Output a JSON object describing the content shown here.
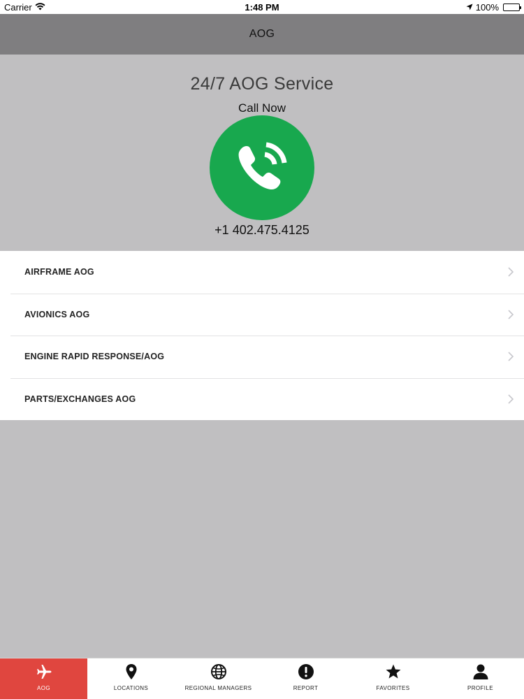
{
  "status_bar": {
    "carrier": "Carrier",
    "time": "1:48 PM",
    "battery": "100%"
  },
  "nav": {
    "title": "AOG"
  },
  "hero": {
    "title": "24/7 AOG Service",
    "call_label": "Call Now",
    "phone": "+1 402.475.4125",
    "call_button_color": "#18a84e"
  },
  "menu": {
    "items": [
      {
        "label": "AIRFRAME AOG"
      },
      {
        "label": "AVIONICS AOG"
      },
      {
        "label": "ENGINE RAPID RESPONSE/AOG"
      },
      {
        "label": "PARTS/EXCHANGES AOG"
      }
    ]
  },
  "tabs": {
    "active_color": "#e0463f",
    "items": [
      {
        "label": "AOG",
        "icon": "airplane-icon",
        "active": true
      },
      {
        "label": "LOCATIONS",
        "icon": "map-pin-icon"
      },
      {
        "label": "REGIONAL MANAGERS",
        "icon": "globe-icon"
      },
      {
        "label": "REPORT",
        "icon": "alert-icon"
      },
      {
        "label": "FAVORITES",
        "icon": "star-icon"
      },
      {
        "label": "PROFILE",
        "icon": "person-icon"
      }
    ]
  }
}
